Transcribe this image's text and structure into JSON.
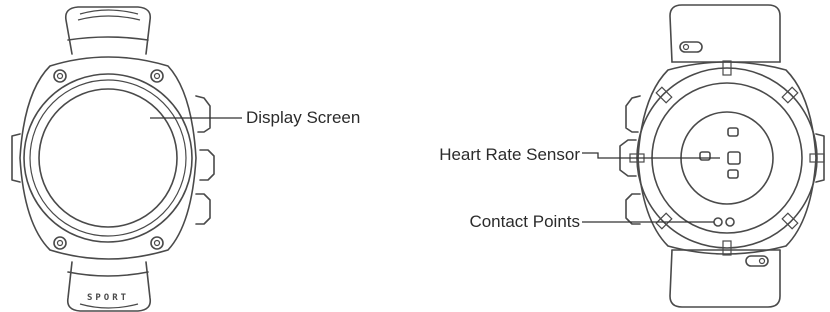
{
  "labels": {
    "display_screen": "Display Screen",
    "heart_rate_sensor": "Heart Rate Sensor",
    "contact_points": "Contact Points"
  },
  "band_text": "SPORT",
  "colors": {
    "line": "#4a4a4a",
    "text": "#2b2b2b",
    "background": "#ffffff"
  }
}
